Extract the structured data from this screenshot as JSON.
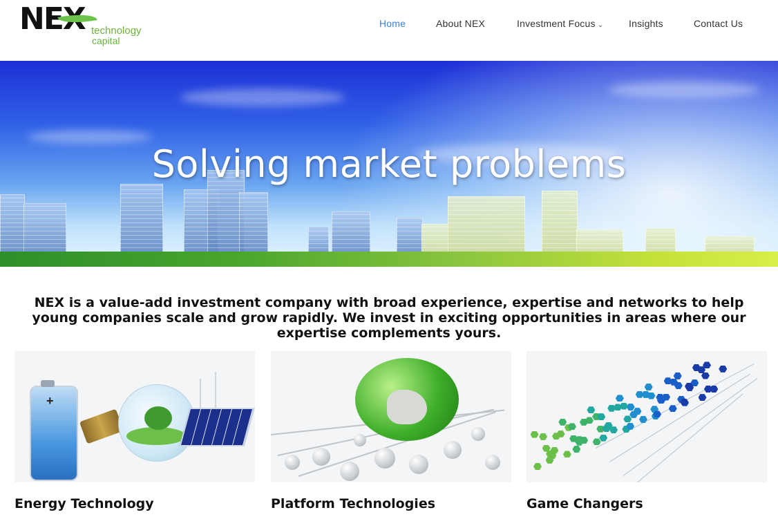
{
  "brand": {
    "name": "NEX",
    "tagline_line1": "technology",
    "tagline_line2": "capital",
    "accent_color": "#6cb33f"
  },
  "nav": {
    "items": [
      {
        "label": "Home",
        "active": true
      },
      {
        "label": "About NEX",
        "active": false
      },
      {
        "label": "Investment Focus",
        "active": false,
        "has_dropdown": true
      },
      {
        "label": "Insights",
        "active": false
      },
      {
        "label": "Contact Us",
        "active": false
      }
    ],
    "active_color": "#3a7fd0"
  },
  "hero": {
    "title": "Solving market problems"
  },
  "intro": {
    "text": "NEX is a value-add investment company with broad experience, expertise and networks to help young companies scale and grow rapidly.  We invest in exciting opportunities in areas where our expertise complements yours."
  },
  "cards": [
    {
      "title": "Energy Technology",
      "image": "energy-technology-image"
    },
    {
      "title": "Platform Technologies",
      "image": "platform-technologies-image"
    },
    {
      "title": "Game Changers",
      "image": "game-changers-image"
    }
  ]
}
